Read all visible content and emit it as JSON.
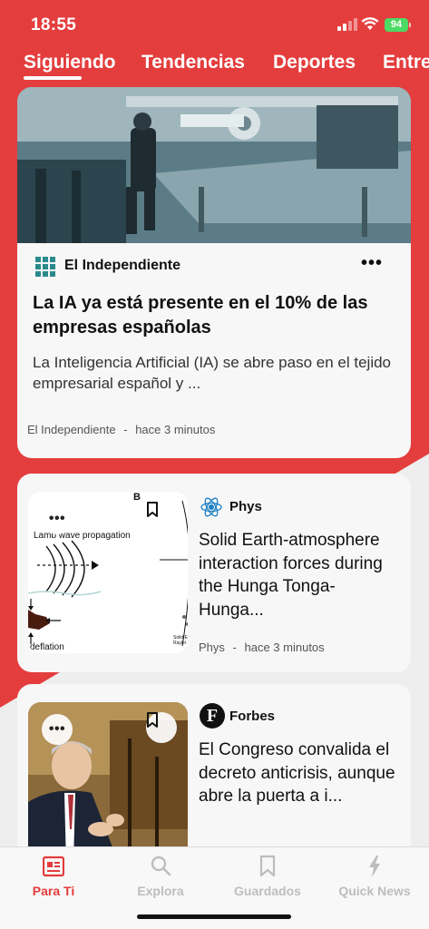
{
  "status_bar": {
    "time": "18:55",
    "battery": "94"
  },
  "tabs": [
    "Siguiendo",
    "Tendencias",
    "Deportes",
    "Entre"
  ],
  "cards": [
    {
      "source": "El Independiente",
      "title": "La IA ya está presente en el 10% de las empresas españolas",
      "summary": "La Inteligencia Artificial (IA) se abre paso en el tejido empresarial español y ...",
      "meta_source": "El Independiente",
      "meta_sep": "-",
      "meta_time": "hace 3 minutos",
      "more": "•••"
    },
    {
      "source": "Phys",
      "title": "Solid Earth-atmosphere interaction forces during the Hunga Tonga-Hunga...",
      "meta_source": "Phys",
      "meta_sep": "-",
      "meta_time": "hace 3 minutos",
      "thumb_text": {
        "panel": "B",
        "label1": "Lamb wave propagation",
        "label2": "deflation",
        "label3": "Solid E",
        "label4": "Rayler"
      }
    },
    {
      "source": "Forbes",
      "logo_letter": "F",
      "title": "El Congreso convalida el decreto anticrisis, aunque abre la puerta a i..."
    }
  ],
  "bottom_nav": [
    {
      "label": "Para Ti",
      "icon": "newspaper-icon",
      "active": true
    },
    {
      "label": "Explora",
      "icon": "search-icon",
      "active": false
    },
    {
      "label": "Guardados",
      "icon": "bookmark-icon",
      "active": false
    },
    {
      "label": "Quick News",
      "icon": "lightning-icon",
      "active": false
    }
  ],
  "colors": {
    "brand_red": "#e33b3b",
    "active_nav": "#e33b3b",
    "inactive_nav": "#bdbdbd"
  }
}
